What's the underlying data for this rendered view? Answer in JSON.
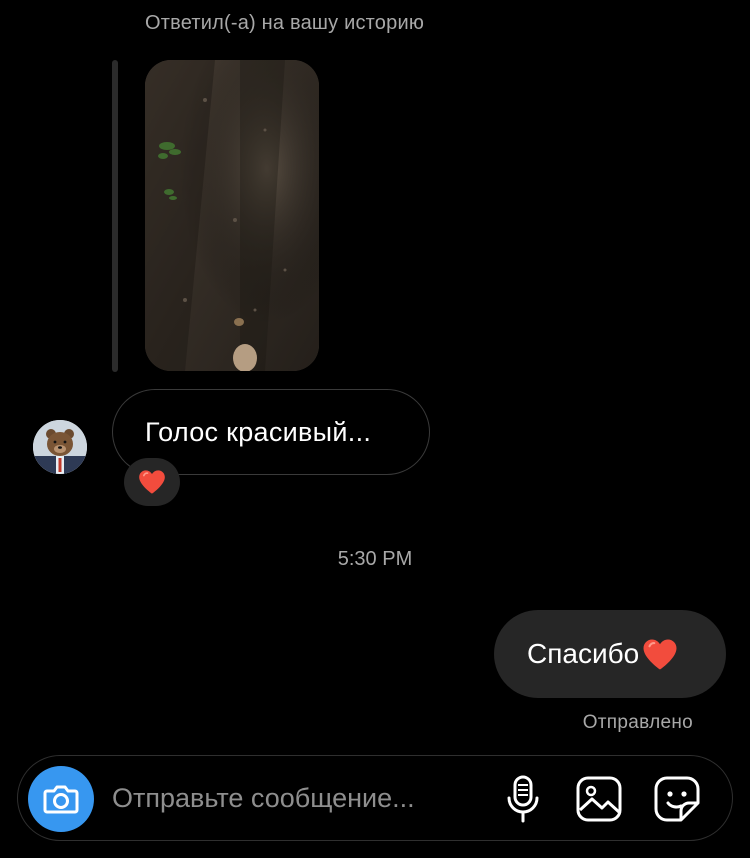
{
  "thread": {
    "reply_caption": "Ответил(-а) на вашу историю",
    "incoming_message": "Голос красивый...",
    "reaction": "heart-emoji",
    "timestamp": "5:30 PM",
    "outgoing_message": "Спасибо",
    "outgoing_emoji": "heart-emoji",
    "status": "Отправлено"
  },
  "composer": {
    "placeholder": "Отправьте сообщение...",
    "icons": [
      "camera-icon",
      "microphone-icon",
      "gallery-icon",
      "sticker-icon"
    ]
  },
  "colors": {
    "background": "#000000",
    "bubble_outgoing": "#262626",
    "accent_camera": "#3797f0",
    "heart": "#f24c3d",
    "muted_text": "#a8a8a8"
  }
}
